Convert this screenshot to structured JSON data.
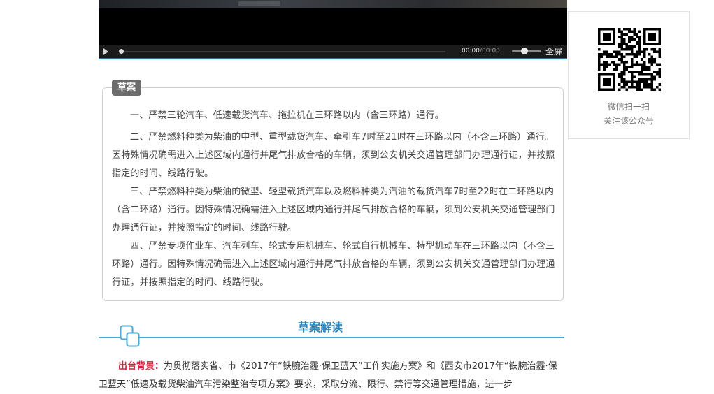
{
  "video": {
    "current_time": "00:00",
    "duration": "/00:00",
    "fullscreen_label": "全屏",
    "progress": 0,
    "volume": 0.4
  },
  "qr": {
    "line1": "微信扫一扫",
    "line2": "关注该公众号"
  },
  "draft": {
    "tag": "草案",
    "paragraphs": [
      "一、严禁三轮汽车、低速载货汽车、拖拉机在三环路以内（含三环路）通行。",
      "二、严禁燃料种类为柴油的中型、重型载货汽车、牵引车7时至21时在三环路以内（不含三环路）通行。因特殊情况确需进入上述区域内通行并尾气排放合格的车辆，须到公安机关交通管理部门办理通行证，并按照指定的时间、线路行驶。",
      "三、严禁燃料种类为柴油的微型、轻型载货汽车以及燃料种类为汽油的载货汽车7时至22时在二环路以内（含二环路）通行。因特殊情况确需进入上述区域内通行并尾气排放合格的车辆，须到公安机关交通管理部门办理通行证，并按照指定的时间、线路行驶。",
      "四、严禁专项作业车、汽车列车、轮式专用机械车、轮式自行机械车、特型机动车在三环路以内（不含三环路）通行。因特殊情况确需进入上述区域内通行并尾气排放合格的车辆，须到公安机关交通管理部门办理通行证，并按照指定的时间、线路行驶。"
    ]
  },
  "interpretation": {
    "title": "草案解读",
    "background_label": "出台背景：",
    "background_text": "为贯彻落实省、市《2017年“铁腕治霾·保卫蓝天”工作实施方案》和《西安市2017年“铁腕治霾·保卫蓝天”低速及载货柴油汽车污染整治专项方案》要求，采取分流、限行、禁行等交通管理措施，进一步"
  },
  "colors": {
    "accent_blue": "#2a82b6",
    "line_blue": "#4ba8d0",
    "label_red": "#d0233c",
    "tag_gray": "#6b6b6b"
  }
}
